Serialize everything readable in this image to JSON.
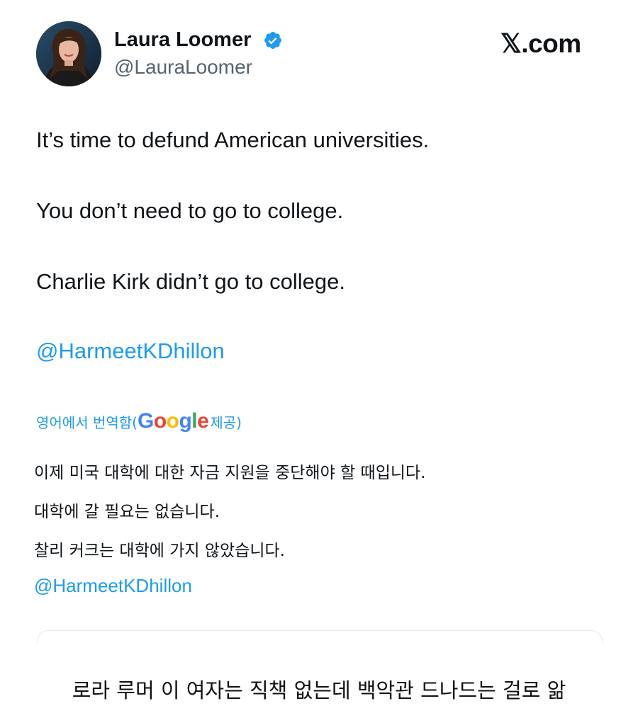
{
  "tweet": {
    "author": {
      "display_name": "Laura Loomer",
      "handle": "@LauraLoomer",
      "verified": true,
      "avatar": "profile-photo"
    },
    "brand": "𝕏.com",
    "lines": [
      "It’s time to defund American universities.",
      "You don’t need to go to college.",
      "Charlie Kirk didn’t go to college."
    ],
    "mention": "@HarmeetKDhillon",
    "translation": {
      "prefix": "영어에서 번역함(",
      "provider": "Google",
      "suffix": " 제공)",
      "lines": [
        "이제 미국 대학에 대한 자금 지원을 중단해야 할 때입니다.",
        "대학에 갈 필요는 없습니다.",
        "찰리 커크는 대학에 가지 않았습니다."
      ],
      "mention": "@HarmeetKDhillon"
    },
    "colors": {
      "link": "#1d9bf0",
      "text": "#0f1419",
      "secondary": "#536471"
    }
  },
  "caption": "로라 루머 이 여자는 직책 없는데 백악관 드나드는 걸로 앎"
}
